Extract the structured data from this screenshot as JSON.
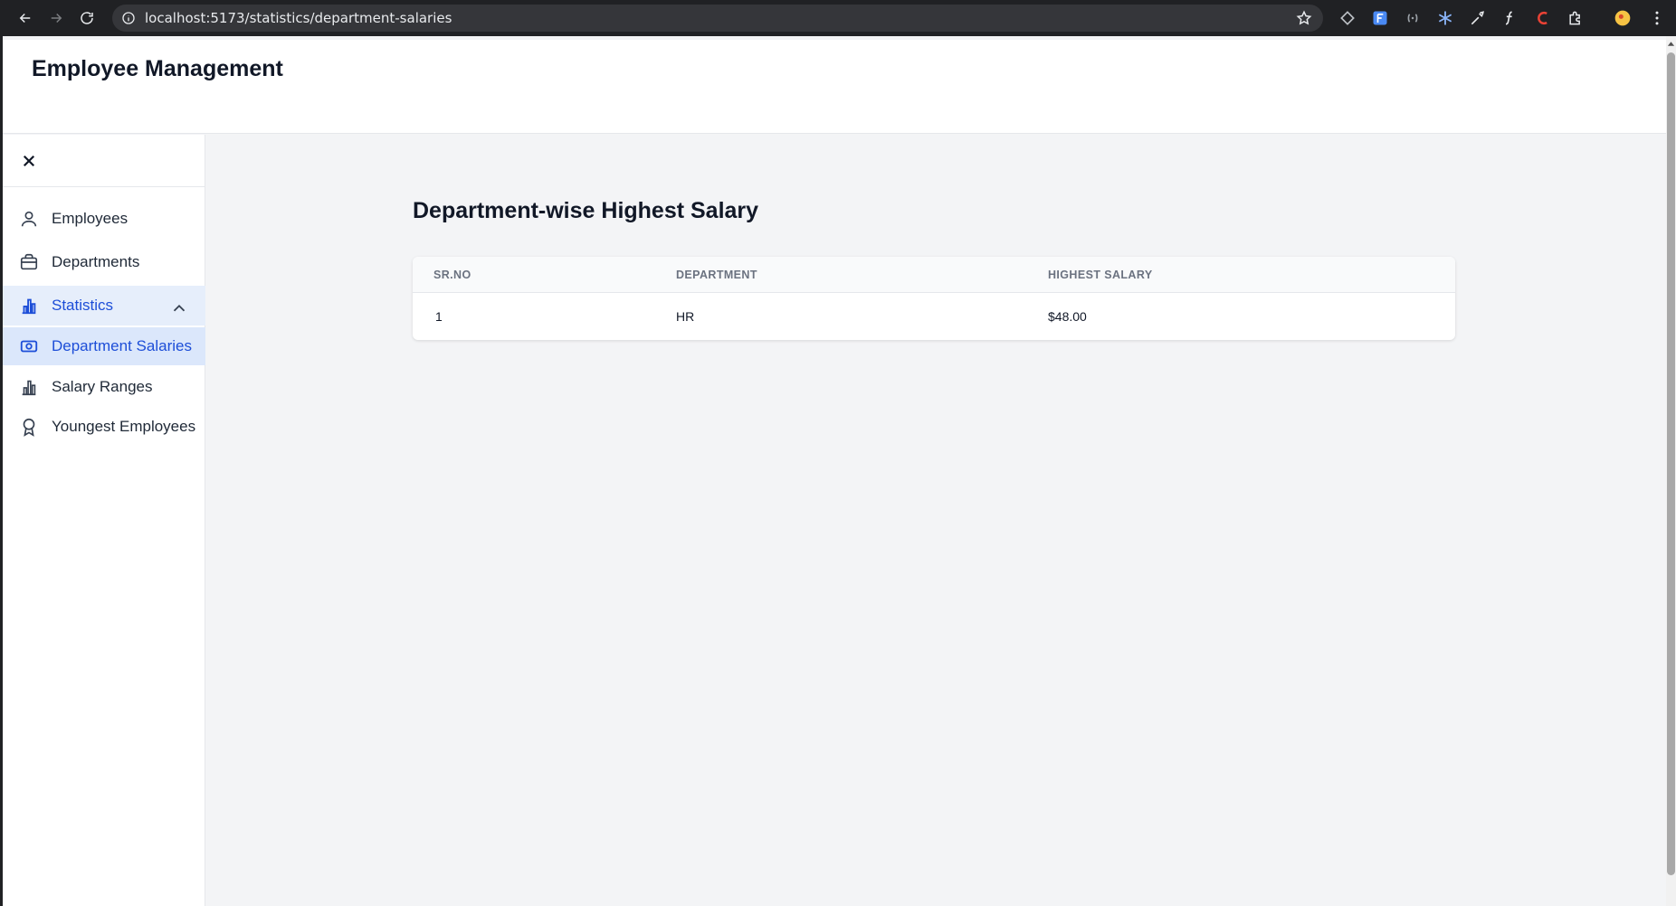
{
  "browser": {
    "url": "localhost:5173/statistics/department-salaries"
  },
  "app": {
    "title": "Employee Management"
  },
  "sidebar": {
    "items": [
      {
        "label": "Employees",
        "icon": "user-icon"
      },
      {
        "label": "Departments",
        "icon": "briefcase-icon"
      },
      {
        "label": "Statistics",
        "icon": "bar-chart-icon",
        "expanded": true
      },
      {
        "label": "Department Salaries",
        "icon": "banknote-icon",
        "active": true
      },
      {
        "label": "Salary Ranges",
        "icon": "bar-chart-icon"
      },
      {
        "label": "Youngest Employees",
        "icon": "award-icon"
      }
    ]
  },
  "main": {
    "heading": "Department-wise Highest Salary",
    "table": {
      "columns": [
        "SR.NO",
        "DEPARTMENT",
        "HIGHEST SALARY"
      ],
      "rows": [
        [
          "1",
          "HR",
          "$48.00"
        ]
      ]
    }
  },
  "colors": {
    "accent": "#1d4ed8",
    "active_bg": "#dbe7fb"
  }
}
